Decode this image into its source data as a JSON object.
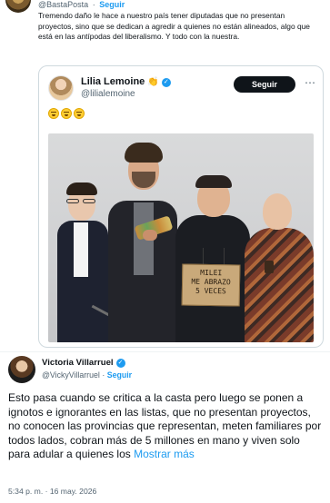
{
  "quoted": {
    "display_name": "",
    "handle": "@BastaPosta",
    "separator": "·",
    "follow_label": "Seguir",
    "text": "Tremendo daño le hace a nuestro país tener diputadas que no presentan proyectos, sino que se dedican a agredir a quienes no están alineados, algo que está en las antípodas del liberalismo. Y todo con la nuestra.",
    "card": {
      "name": "Lilia Lemoine",
      "handle": "@lilialemoine",
      "follow_label": "Seguir",
      "more_icon": "more-icon",
      "emoji_count": 3,
      "sign_lines": [
        "MILEI",
        "ME ABRAZO",
        "5 VECES"
      ]
    }
  },
  "main": {
    "name": "Victoria Villarruel",
    "handle": "@VickyVillarruel",
    "separator": "·",
    "follow_label": "Seguir",
    "text": "Esto pasa cuando se critica a la casta pero luego se ponen a ignotos e ignorantes en las listas, que no presentan proyectos, no conocen las provincias que representan, meten familiares por todos lados, cobran más de 5 millones en mano y viven solo para adular a quienes los",
    "show_more": "Mostrar más",
    "timestamp": "5:34 p. m. · 16 may. 2026"
  },
  "colors": {
    "accent": "#1d9bf0",
    "text": "#0f1419",
    "muted": "#536471",
    "border": "#cfd9de"
  }
}
